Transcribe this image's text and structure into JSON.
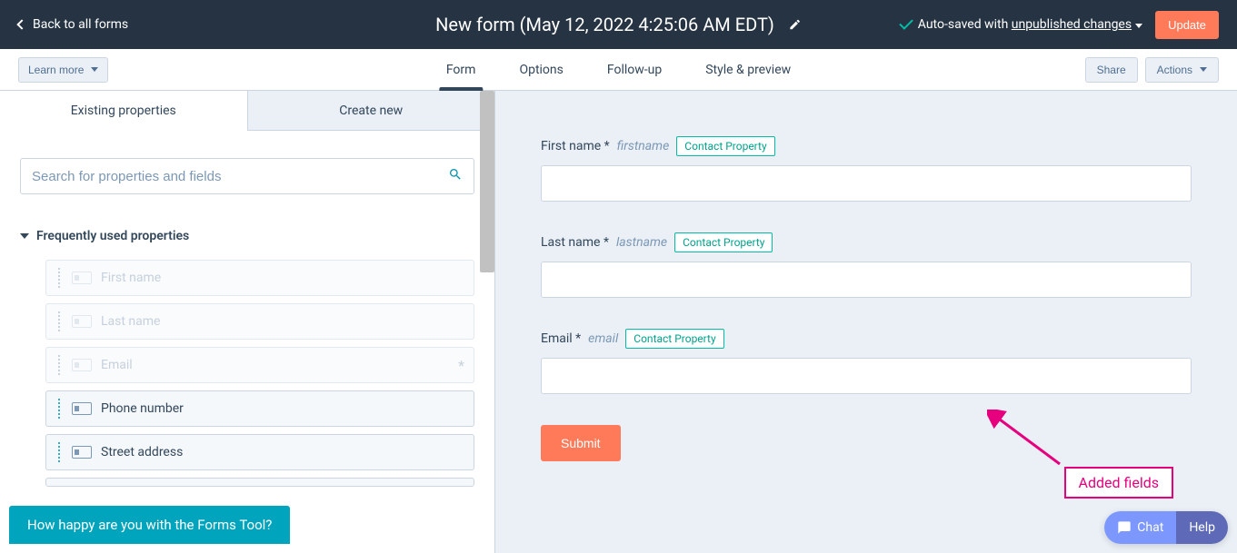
{
  "topbar": {
    "back_label": "Back to all forms",
    "title": "New form (May 12, 2022 4:25:06 AM EDT)",
    "autosave_prefix": "Auto-saved with ",
    "autosave_changes": "unpublished changes",
    "update_label": "Update"
  },
  "secondbar": {
    "learn_label": "Learn more",
    "tabs": {
      "form": "Form",
      "options": "Options",
      "followup": "Follow-up",
      "style": "Style & preview"
    },
    "share_label": "Share",
    "actions_label": "Actions"
  },
  "left": {
    "tabs": {
      "existing": "Existing properties",
      "create": "Create new"
    },
    "search_placeholder": "Search for properties and fields",
    "section_title": "Frequently used properties",
    "items": [
      {
        "label": "First name",
        "disabled": true
      },
      {
        "label": "Last name",
        "disabled": true
      },
      {
        "label": "Email",
        "disabled": true,
        "required": true
      },
      {
        "label": "Phone number",
        "disabled": false
      },
      {
        "label": "Street address",
        "disabled": false
      }
    ]
  },
  "right": {
    "tag": "Contact Property",
    "fields": [
      {
        "label": "First name *",
        "internal": "firstname"
      },
      {
        "label": "Last name *",
        "internal": "lastname"
      },
      {
        "label": "Email *",
        "internal": "email"
      }
    ],
    "submit_label": "Submit",
    "annotation": "Added fields"
  },
  "bottom": {
    "feedback": "How happy are you with the Forms Tool?",
    "chat": "Chat",
    "help": "Help"
  }
}
